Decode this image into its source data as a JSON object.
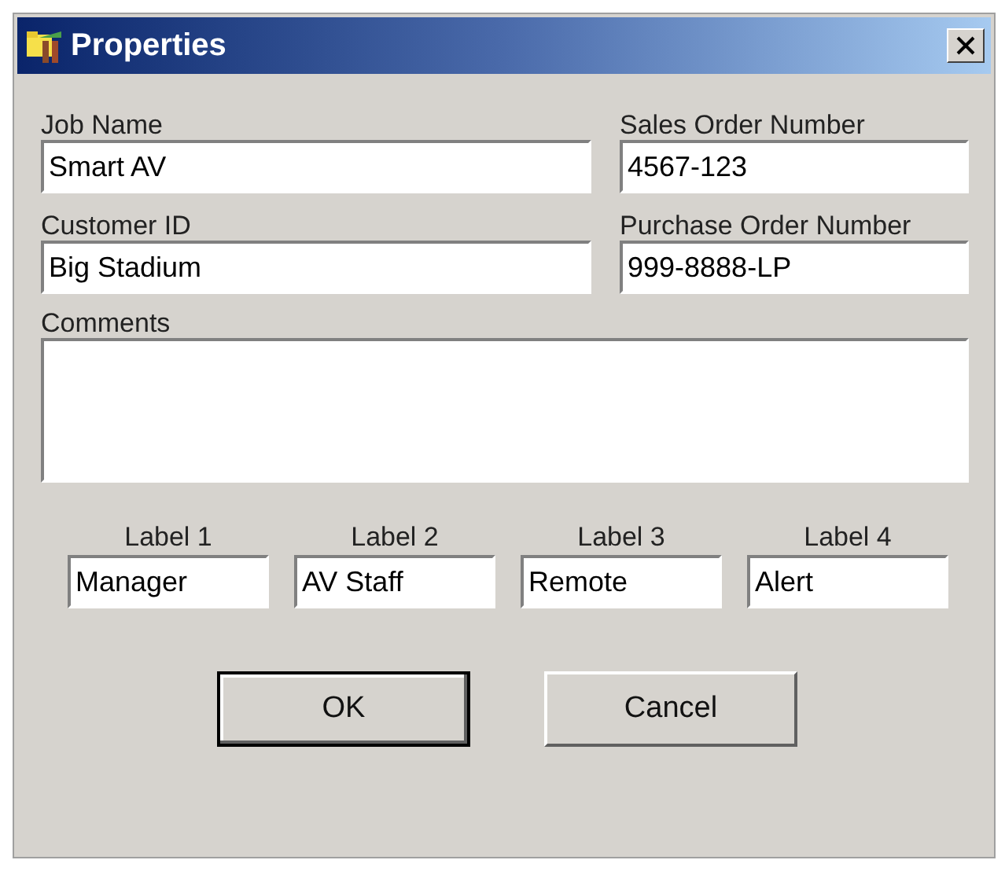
{
  "window": {
    "title": "Properties"
  },
  "fields": [
    {
      "label": "Job Name",
      "value": "Smart AV"
    },
    {
      "label": "Sales Order Number",
      "value": "4567-123"
    },
    {
      "label": "Customer ID",
      "value": "Big Stadium"
    },
    {
      "label": "Purchase Order Number",
      "value": "999-8888-LP"
    }
  ],
  "comments": {
    "label": "Comments"
  },
  "labels": [
    {
      "label": "Label 1",
      "value": "Manager"
    },
    {
      "label": "Label 2",
      "value": "AV Staff"
    },
    {
      "label": "Label 3",
      "value": "Remote"
    },
    {
      "label": "Label 4",
      "value": "Alert"
    }
  ],
  "buttons": [
    {
      "label": "OK",
      "default": true
    },
    {
      "label": "Cancel",
      "default": false
    }
  ]
}
